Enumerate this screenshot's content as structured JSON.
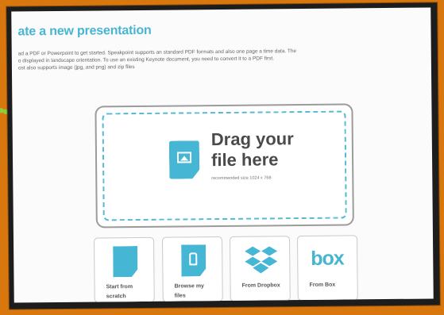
{
  "page": {
    "title": "ate a new presentation",
    "description_lines": [
      "ad a PDF or Powerpoint to get started. Speakpoint supports an standard PDF formats and also one page a time data. The",
      "o displayed in landscape orientation. To use an existing Keynote document, you need to convert it to a PDF first.",
      "ost also supports image (jpg, and png) and zip files"
    ]
  },
  "upload": {
    "title_line_1": "Drag your",
    "title_line_2": "file here",
    "subtitle": "recommended size 1024 x 768"
  },
  "options": [
    {
      "label": "Start from scratch",
      "icon": "document-icon"
    },
    {
      "label": "Browse my files",
      "icon": "folder-file-icon"
    },
    {
      "label": "From Dropbox",
      "icon": "dropbox-icon"
    },
    {
      "label": "From Box",
      "icon": "box-icon"
    }
  ],
  "colors": {
    "background": "#d9770f",
    "accent": "#45b6d3",
    "arrow": "#8ccf38",
    "frame": "#1d1d1d"
  }
}
